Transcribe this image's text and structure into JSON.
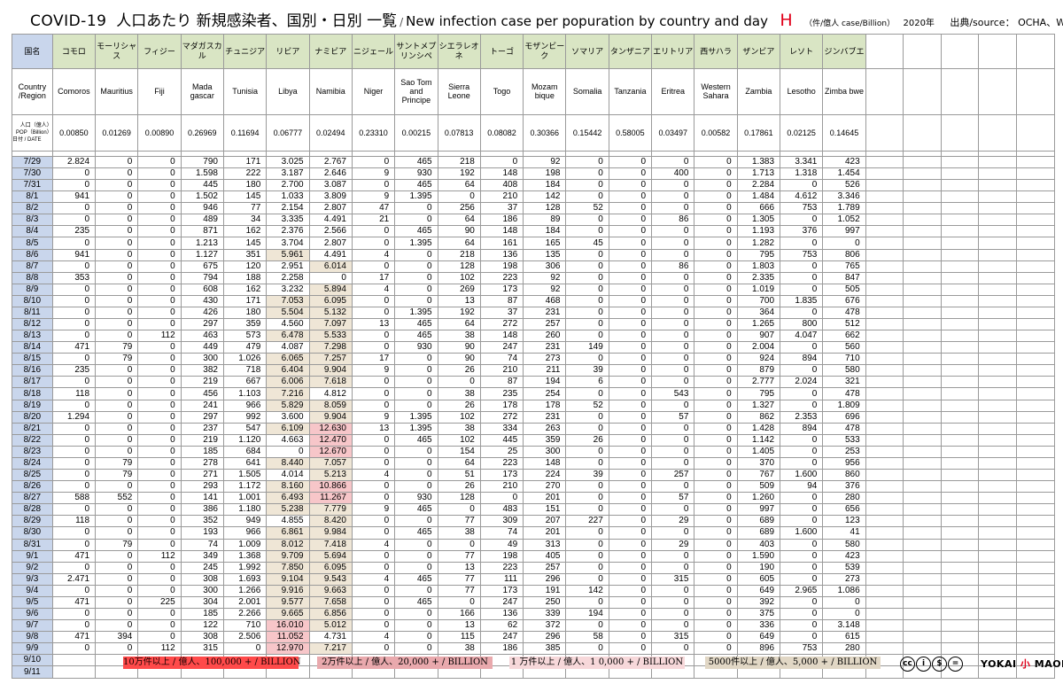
{
  "title": {
    "prefix": "COVID-19",
    "ja": "人口あたり 新規感染者、国別・日別 一覧",
    "en": "New infection case per popuration by country and day",
    "sheet_letter": "H",
    "unit": "（件/億人 case/Billion）",
    "year": "2020年",
    "source": "出典/source： OCHA、Wikipedia"
  },
  "header": {
    "label_ja": "国名",
    "label_en": "Country /Region",
    "label_pop_top": "人口（億人）POP（Billion）",
    "label_pop_bottom": "日付 / DATE"
  },
  "countries": [
    {
      "ja": "コモロ",
      "en": "Comoros",
      "pop": "0.00850"
    },
    {
      "ja": "モーリシャス",
      "en": "Mauritius",
      "pop": "0.01269"
    },
    {
      "ja": "フィジー",
      "en": "Fiji",
      "pop": "0.00890"
    },
    {
      "ja": "マダガスカル",
      "en": "Mada gascar",
      "pop": "0.26969"
    },
    {
      "ja": "チュニジア",
      "en": "Tunisia",
      "pop": "0.11694"
    },
    {
      "ja": "リビア",
      "en": "Libya",
      "pop": "0.06777"
    },
    {
      "ja": "ナミビア",
      "en": "Namibia",
      "pop": "0.02494"
    },
    {
      "ja": "ニジェール",
      "en": "Niger",
      "pop": "0.23310"
    },
    {
      "ja": "サントメプリンシペ",
      "en": "Sao Tom and Principe",
      "pop": "0.00215"
    },
    {
      "ja": "シエラレオネ",
      "en": "Sierra Leone",
      "pop": "0.07813"
    },
    {
      "ja": "トーゴ",
      "en": "Togo",
      "pop": "0.08082"
    },
    {
      "ja": "モザンビーク",
      "en": "Mozam bique",
      "pop": "0.30366"
    },
    {
      "ja": "ソマリア",
      "en": "Somalia",
      "pop": "0.15442"
    },
    {
      "ja": "タンザニア",
      "en": "Tanzania",
      "pop": "0.58005"
    },
    {
      "ja": "エリトリア",
      "en": "Eritrea",
      "pop": "0.03497"
    },
    {
      "ja": "西サハラ",
      "en": "Western Sahara",
      "pop": "0.00582"
    },
    {
      "ja": "ザンビア",
      "en": "Zambia",
      "pop": "0.17861"
    },
    {
      "ja": "レソト",
      "en": "Lesotho",
      "pop": "0.02125"
    },
    {
      "ja": "ジンバブエ",
      "en": "Zimba bwe",
      "pop": "0.14645"
    }
  ],
  "rows": [
    {
      "date": "7/29",
      "v": [
        "2.824",
        "0",
        "0",
        "790",
        "171",
        "3.025",
        "2.767",
        "0",
        "465",
        "218",
        "0",
        "92",
        "0",
        "0",
        "0",
        "0",
        "1.383",
        "3.341",
        "423"
      ]
    },
    {
      "date": "7/30",
      "v": [
        "0",
        "0",
        "0",
        "1.598",
        "222",
        "3.187",
        "2.646",
        "9",
        "930",
        "192",
        "148",
        "198",
        "0",
        "0",
        "400",
        "0",
        "1.713",
        "1.318",
        "1.454"
      ]
    },
    {
      "date": "7/31",
      "v": [
        "0",
        "0",
        "0",
        "445",
        "180",
        "2.700",
        "3.087",
        "0",
        "465",
        "64",
        "408",
        "184",
        "0",
        "0",
        "0",
        "0",
        "2.284",
        "0",
        "526"
      ]
    },
    {
      "date": "8/1",
      "v": [
        "941",
        "0",
        "0",
        "1.502",
        "145",
        "1.033",
        "3.809",
        "9",
        "1.395",
        "0",
        "210",
        "142",
        "0",
        "0",
        "0",
        "0",
        "1.484",
        "4.612",
        "3.346"
      ]
    },
    {
      "date": "8/2",
      "v": [
        "0",
        "0",
        "0",
        "946",
        "77",
        "2.154",
        "2.807",
        "47",
        "0",
        "256",
        "37",
        "128",
        "52",
        "0",
        "0",
        "0",
        "666",
        "753",
        "1.789"
      ]
    },
    {
      "date": "8/3",
      "v": [
        "0",
        "0",
        "0",
        "489",
        "34",
        "3.335",
        "4.491",
        "21",
        "0",
        "64",
        "186",
        "89",
        "0",
        "0",
        "86",
        "0",
        "1.305",
        "0",
        "1.052"
      ]
    },
    {
      "date": "8/4",
      "v": [
        "235",
        "0",
        "0",
        "871",
        "162",
        "2.376",
        "2.566",
        "0",
        "465",
        "90",
        "148",
        "184",
        "0",
        "0",
        "0",
        "0",
        "1.193",
        "376",
        "997"
      ]
    },
    {
      "date": "8/5",
      "v": [
        "0",
        "0",
        "0",
        "1.213",
        "145",
        "3.704",
        "2.807",
        "0",
        "1.395",
        "64",
        "161",
        "165",
        "45",
        "0",
        "0",
        "0",
        "1.282",
        "0",
        "0"
      ]
    },
    {
      "date": "8/6",
      "v": [
        "941",
        "0",
        "0",
        "1.127",
        "351",
        "5.961",
        "4.491",
        "4",
        "0",
        "218",
        "136",
        "135",
        "0",
        "0",
        "0",
        "0",
        "795",
        "753",
        "806"
      ]
    },
    {
      "date": "8/7",
      "v": [
        "0",
        "0",
        "0",
        "675",
        "120",
        "2.951",
        "6.014",
        "0",
        "0",
        "128",
        "198",
        "306",
        "0",
        "0",
        "86",
        "0",
        "1.803",
        "0",
        "765"
      ]
    },
    {
      "date": "8/8",
      "v": [
        "353",
        "0",
        "0",
        "794",
        "188",
        "2.258",
        "0",
        "17",
        "0",
        "102",
        "223",
        "92",
        "0",
        "0",
        "0",
        "0",
        "2.335",
        "0",
        "847"
      ]
    },
    {
      "date": "8/9",
      "v": [
        "0",
        "0",
        "0",
        "608",
        "162",
        "3.232",
        "5.894",
        "4",
        "0",
        "269",
        "173",
        "92",
        "0",
        "0",
        "0",
        "0",
        "1.019",
        "0",
        "505"
      ]
    },
    {
      "date": "8/10",
      "v": [
        "0",
        "0",
        "0",
        "430",
        "171",
        "7.053",
        "6.095",
        "0",
        "0",
        "13",
        "87",
        "468",
        "0",
        "0",
        "0",
        "0",
        "700",
        "1.835",
        "676"
      ]
    },
    {
      "date": "8/11",
      "v": [
        "0",
        "0",
        "0",
        "426",
        "180",
        "5.504",
        "5.132",
        "0",
        "1.395",
        "192",
        "37",
        "231",
        "0",
        "0",
        "0",
        "0",
        "364",
        "0",
        "478"
      ]
    },
    {
      "date": "8/12",
      "v": [
        "0",
        "0",
        "0",
        "297",
        "359",
        "4.560",
        "7.097",
        "13",
        "465",
        "64",
        "272",
        "257",
        "0",
        "0",
        "0",
        "0",
        "1.265",
        "800",
        "512"
      ]
    },
    {
      "date": "8/13",
      "v": [
        "0",
        "0",
        "112",
        "463",
        "573",
        "6.478",
        "5.533",
        "0",
        "465",
        "38",
        "148",
        "260",
        "0",
        "0",
        "0",
        "0",
        "907",
        "4.047",
        "662"
      ]
    },
    {
      "date": "8/14",
      "v": [
        "471",
        "79",
        "0",
        "449",
        "479",
        "4.087",
        "7.298",
        "0",
        "930",
        "90",
        "247",
        "231",
        "149",
        "0",
        "0",
        "0",
        "2.004",
        "0",
        "560"
      ]
    },
    {
      "date": "8/15",
      "v": [
        "0",
        "79",
        "0",
        "300",
        "1.026",
        "6.065",
        "7.257",
        "17",
        "0",
        "90",
        "74",
        "273",
        "0",
        "0",
        "0",
        "0",
        "924",
        "894",
        "710"
      ]
    },
    {
      "date": "8/16",
      "v": [
        "235",
        "0",
        "0",
        "382",
        "718",
        "6.404",
        "9.904",
        "9",
        "0",
        "26",
        "210",
        "211",
        "39",
        "0",
        "0",
        "0",
        "879",
        "0",
        "580"
      ]
    },
    {
      "date": "8/17",
      "v": [
        "0",
        "0",
        "0",
        "219",
        "667",
        "6.006",
        "7.618",
        "0",
        "0",
        "0",
        "87",
        "194",
        "6",
        "0",
        "0",
        "0",
        "2.777",
        "2.024",
        "321"
      ]
    },
    {
      "date": "8/18",
      "v": [
        "118",
        "0",
        "0",
        "456",
        "1.103",
        "7.216",
        "4.812",
        "0",
        "0",
        "38",
        "235",
        "254",
        "0",
        "0",
        "543",
        "0",
        "795",
        "0",
        "478"
      ]
    },
    {
      "date": "8/19",
      "v": [
        "0",
        "0",
        "0",
        "241",
        "966",
        "5.829",
        "8.059",
        "0",
        "0",
        "26",
        "178",
        "178",
        "52",
        "0",
        "0",
        "0",
        "1.327",
        "0",
        "1.809"
      ]
    },
    {
      "date": "8/20",
      "v": [
        "1.294",
        "0",
        "0",
        "297",
        "992",
        "3.600",
        "9.904",
        "9",
        "1.395",
        "102",
        "272",
        "231",
        "0",
        "0",
        "57",
        "0",
        "862",
        "2.353",
        "696"
      ]
    },
    {
      "date": "8/21",
      "v": [
        "0",
        "0",
        "0",
        "237",
        "547",
        "6.109",
        "12.630",
        "13",
        "1.395",
        "38",
        "334",
        "263",
        "0",
        "0",
        "0",
        "0",
        "1.428",
        "894",
        "478"
      ]
    },
    {
      "date": "8/22",
      "v": [
        "0",
        "0",
        "0",
        "219",
        "1.120",
        "4.663",
        "12.470",
        "0",
        "465",
        "102",
        "445",
        "359",
        "26",
        "0",
        "0",
        "0",
        "1.142",
        "0",
        "533"
      ]
    },
    {
      "date": "8/23",
      "v": [
        "0",
        "0",
        "0",
        "185",
        "684",
        "0",
        "12.670",
        "0",
        "0",
        "154",
        "25",
        "300",
        "0",
        "0",
        "0",
        "0",
        "1.405",
        "0",
        "253"
      ]
    },
    {
      "date": "8/24",
      "v": [
        "0",
        "79",
        "0",
        "278",
        "641",
        "8.440",
        "7.057",
        "0",
        "0",
        "64",
        "223",
        "148",
        "0",
        "0",
        "0",
        "0",
        "370",
        "0",
        "956"
      ]
    },
    {
      "date": "8/25",
      "v": [
        "0",
        "79",
        "0",
        "271",
        "1.505",
        "4.014",
        "5.213",
        "4",
        "0",
        "51",
        "173",
        "224",
        "39",
        "0",
        "257",
        "0",
        "767",
        "1.600",
        "860"
      ]
    },
    {
      "date": "8/26",
      "v": [
        "0",
        "0",
        "0",
        "293",
        "1.172",
        "8.160",
        "10.866",
        "0",
        "0",
        "26",
        "210",
        "270",
        "0",
        "0",
        "0",
        "0",
        "509",
        "94",
        "376"
      ]
    },
    {
      "date": "8/27",
      "v": [
        "588",
        "552",
        "0",
        "141",
        "1.001",
        "6.493",
        "11.267",
        "0",
        "930",
        "128",
        "0",
        "201",
        "0",
        "0",
        "57",
        "0",
        "1.260",
        "0",
        "280"
      ]
    },
    {
      "date": "8/28",
      "v": [
        "0",
        "0",
        "0",
        "386",
        "1.180",
        "5.238",
        "7.779",
        "9",
        "465",
        "0",
        "483",
        "151",
        "0",
        "0",
        "0",
        "0",
        "997",
        "0",
        "656"
      ]
    },
    {
      "date": "8/29",
      "v": [
        "118",
        "0",
        "0",
        "352",
        "949",
        "4.855",
        "8.420",
        "0",
        "0",
        "77",
        "309",
        "207",
        "227",
        "0",
        "29",
        "0",
        "689",
        "0",
        "123"
      ]
    },
    {
      "date": "8/30",
      "v": [
        "0",
        "0",
        "0",
        "193",
        "966",
        "6.861",
        "9.984",
        "0",
        "465",
        "38",
        "74",
        "201",
        "0",
        "0",
        "0",
        "0",
        "689",
        "1.600",
        "41"
      ]
    },
    {
      "date": "8/31",
      "v": [
        "0",
        "79",
        "0",
        "74",
        "1.009",
        "8.012",
        "7.418",
        "4",
        "0",
        "0",
        "49",
        "313",
        "0",
        "0",
        "29",
        "0",
        "403",
        "0",
        "580"
      ]
    },
    {
      "date": "9/1",
      "v": [
        "471",
        "0",
        "112",
        "349",
        "1.368",
        "9.709",
        "5.694",
        "0",
        "0",
        "77",
        "198",
        "405",
        "0",
        "0",
        "0",
        "0",
        "1.590",
        "0",
        "423"
      ]
    },
    {
      "date": "9/2",
      "v": [
        "0",
        "0",
        "0",
        "245",
        "1.992",
        "7.850",
        "6.095",
        "0",
        "0",
        "13",
        "223",
        "257",
        "0",
        "0",
        "0",
        "0",
        "190",
        "0",
        "539"
      ]
    },
    {
      "date": "9/3",
      "v": [
        "2.471",
        "0",
        "0",
        "308",
        "1.693",
        "9.104",
        "9.543",
        "4",
        "465",
        "77",
        "111",
        "296",
        "0",
        "0",
        "315",
        "0",
        "605",
        "0",
        "273"
      ]
    },
    {
      "date": "9/4",
      "v": [
        "0",
        "0",
        "0",
        "300",
        "1.266",
        "9.916",
        "9.663",
        "0",
        "0",
        "77",
        "173",
        "191",
        "142",
        "0",
        "0",
        "0",
        "649",
        "2.965",
        "1.086"
      ]
    },
    {
      "date": "9/5",
      "v": [
        "471",
        "0",
        "225",
        "304",
        "2.001",
        "9.577",
        "7.658",
        "0",
        "465",
        "0",
        "247",
        "250",
        "0",
        "0",
        "0",
        "0",
        "392",
        "0",
        "0"
      ]
    },
    {
      "date": "9/6",
      "v": [
        "0",
        "0",
        "0",
        "185",
        "2.266",
        "9.665",
        "6.856",
        "0",
        "0",
        "166",
        "136",
        "339",
        "194",
        "0",
        "0",
        "0",
        "375",
        "0",
        "0"
      ]
    },
    {
      "date": "9/7",
      "v": [
        "0",
        "0",
        "0",
        "122",
        "710",
        "16.010",
        "5.012",
        "0",
        "0",
        "13",
        "62",
        "372",
        "0",
        "0",
        "0",
        "0",
        "336",
        "0",
        "3.148"
      ]
    },
    {
      "date": "9/8",
      "v": [
        "471",
        "394",
        "0",
        "308",
        "2.506",
        "11.052",
        "4.731",
        "4",
        "0",
        "115",
        "247",
        "296",
        "58",
        "0",
        "315",
        "0",
        "649",
        "0",
        "615"
      ]
    },
    {
      "date": "9/9",
      "v": [
        "0",
        "0",
        "112",
        "315",
        "0",
        "12.970",
        "7.217",
        "0",
        "0",
        "38",
        "186",
        "385",
        "0",
        "0",
        "0",
        "0",
        "896",
        "753",
        "280"
      ]
    }
  ],
  "footer_dates": [
    "9/10",
    "9/11"
  ],
  "legend": [
    {
      "label": "10万件以上 / 億人、100,000 + / BILLION",
      "color": "#ff4a4a"
    },
    {
      "label": "2万件以上 / 億人、20,000 + / BILLION",
      "color": "#e9a9ad"
    },
    {
      "label": "1 万件以上 / 億人、1 0,000 + / BILLION",
      "color": "#f7d8da"
    },
    {
      "label": "5000件以上 / 億人、5,000 + / BILLION",
      "color": "#e1d7c5"
    }
  ],
  "license": [
    "cc",
    "by",
    "nc",
    "nd"
  ],
  "brand": {
    "left": "YOKAI",
    "mid": "小",
    "right": "MAOH"
  }
}
